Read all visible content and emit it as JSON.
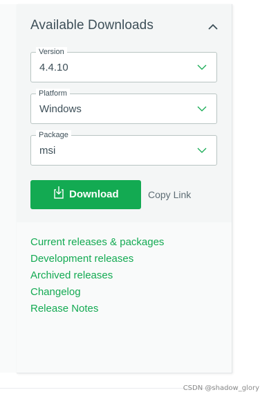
{
  "panel": {
    "title": "Available Downloads"
  },
  "fields": {
    "version": {
      "legend": "Version",
      "value": "4.4.10"
    },
    "platform": {
      "legend": "Platform",
      "value": "Windows"
    },
    "package": {
      "legend": "Package",
      "value": "msi"
    }
  },
  "actions": {
    "download_label": "Download",
    "copy_link_label": "Copy Link"
  },
  "links": [
    "Current releases & packages",
    "Development releases",
    "Archived releases",
    "Changelog",
    "Release Notes"
  ],
  "watermark": "CSDN @shadow_glory",
  "colors": {
    "accent": "#13aa52",
    "text": "#3d4f58",
    "border": "#b8c4c2",
    "panel_bg": "#f4f6f6"
  },
  "icons": {
    "collapse": "chevron-up-icon",
    "dropdown": "chevron-down-icon",
    "download": "download-icon"
  }
}
